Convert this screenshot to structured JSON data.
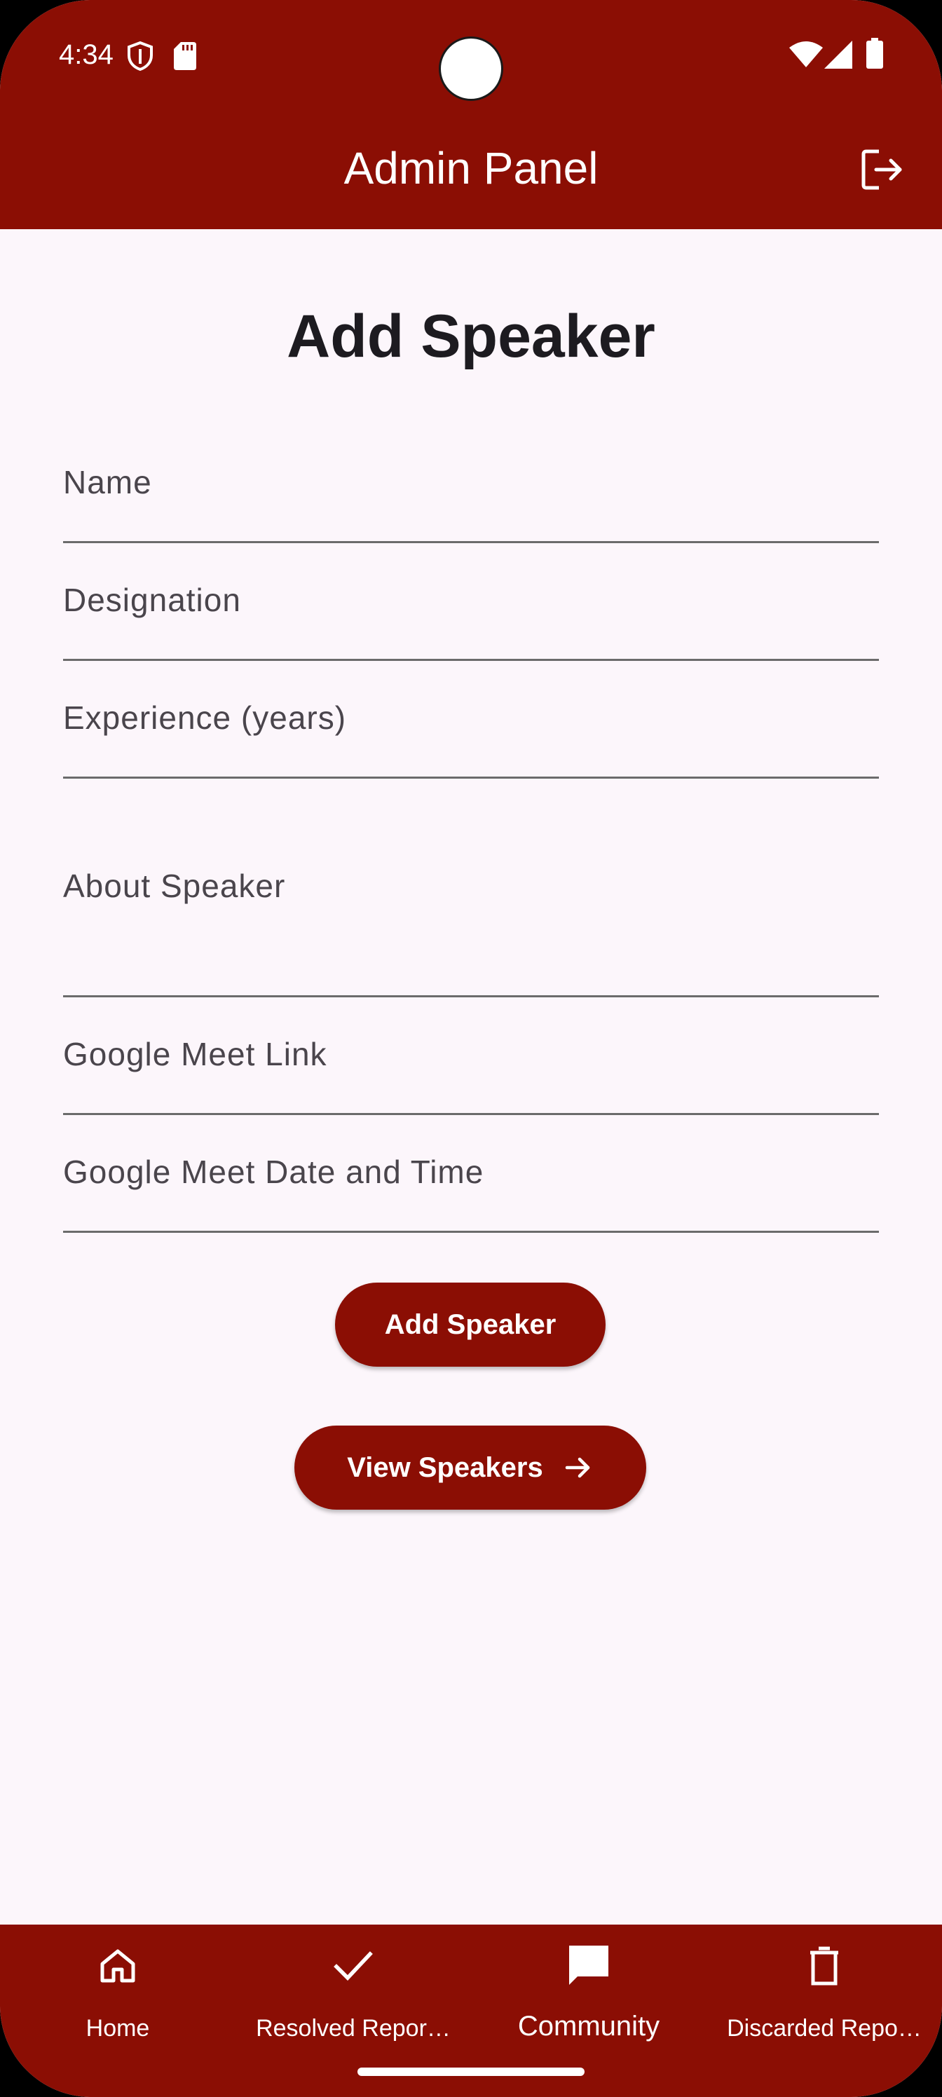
{
  "status_bar": {
    "time": "4:34",
    "icons": [
      "shield-icon",
      "sd-card-icon",
      "wifi-icon",
      "signal-icon",
      "battery-icon"
    ]
  },
  "app_bar": {
    "title": "Admin Panel",
    "logout_icon": "logout-icon"
  },
  "form": {
    "heading": "Add Speaker",
    "fields": [
      {
        "label": "Name",
        "value": ""
      },
      {
        "label": "Designation",
        "value": ""
      },
      {
        "label": "Experience (years)",
        "value": ""
      },
      {
        "label": "About Speaker",
        "value": ""
      },
      {
        "label": "Google Meet Link",
        "value": ""
      },
      {
        "label": "Google Meet Date and Time",
        "value": ""
      }
    ],
    "submit_label": "Add Speaker",
    "view_label": "View Speakers"
  },
  "bottom_nav": {
    "items": [
      {
        "label": "Home",
        "icon": "home-icon",
        "active": false
      },
      {
        "label": "Resolved Repor…",
        "icon": "check-icon",
        "active": false
      },
      {
        "label": "Community",
        "icon": "chat-bubble-icon",
        "active": true
      },
      {
        "label": "Discarded Repo…",
        "icon": "trash-icon",
        "active": false
      }
    ]
  },
  "colors": {
    "primary": "#8b0e04",
    "background": "#fcf6fb",
    "on_primary": "#ffffff",
    "text": "#1d1b20",
    "label": "#4a454c"
  }
}
